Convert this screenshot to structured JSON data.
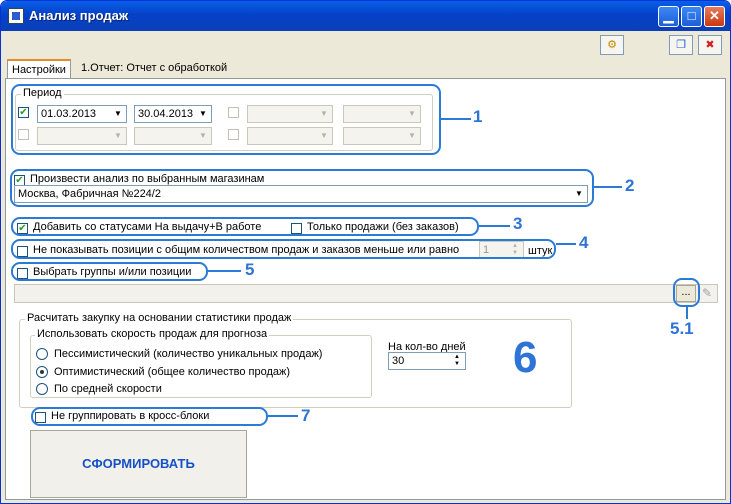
{
  "window": {
    "title": "Анализ продаж",
    "minimize_glyph": "▁",
    "maximize_glyph": "□",
    "close_glyph": "✕"
  },
  "toolbar": {
    "settings_icon": "⚙",
    "copy_icon": "❐",
    "exit_icon": "✖"
  },
  "tabs": [
    {
      "label": "Настройки"
    },
    {
      "label": "1.Отчет: Отчет с обработкой"
    }
  ],
  "period": {
    "title": "Период",
    "row1": {
      "checked": "✔",
      "date_from": "01.03.2013",
      "date_to": "30.04.2013"
    }
  },
  "stores": {
    "label": "Произвести анализ по выбранным магазинам",
    "checked": "✔",
    "value": "Москва, Фабричная №224/2"
  },
  "statuses": {
    "label": "Добавить со статусами На выдачу+В работе",
    "checked": "✔",
    "sales_only_label": "Только продажи (без заказов)"
  },
  "threshold": {
    "label": "Не показывать позиции с общим количеством продаж и заказов меньше или равно",
    "value": "1",
    "unit": "штук"
  },
  "groups": {
    "label": "Выбрать группы и/или позиции",
    "more_button": "..."
  },
  "purchase": {
    "title": "Расчитать закупку на основании статистики продаж",
    "speed_title": "Использовать скорость продаж для прогноза",
    "options": [
      "Пессимистический (количество уникальных продаж)",
      "Оптимистический (общее количество продаж)",
      "По средней скорости"
    ],
    "selected_index": 1,
    "days_label": "На кол-во дней",
    "days_value": "30"
  },
  "crossblock": {
    "label": "Не группировать в кросс-блоки"
  },
  "generate_button": "СФОРМИРОВАТЬ",
  "callouts": {
    "n1": "1",
    "n2": "2",
    "n3": "3",
    "n4": "4",
    "n5": "5",
    "n51": "5.1",
    "n6": "6",
    "n7": "7"
  }
}
